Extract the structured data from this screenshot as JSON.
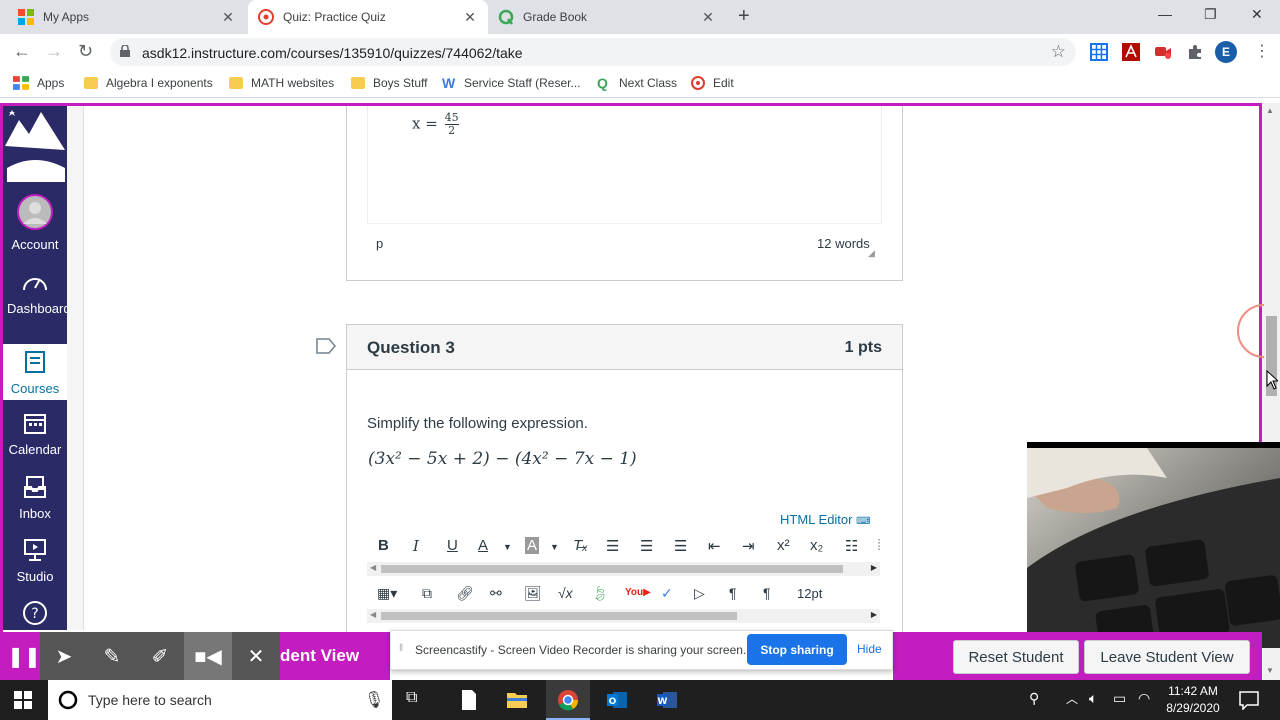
{
  "browser": {
    "tabs": [
      {
        "title": "My Apps",
        "active": false
      },
      {
        "title": "Quiz: Practice Quiz",
        "active": true
      },
      {
        "title": "Grade Book",
        "active": false
      }
    ],
    "url": "asdk12.instructure.com/courses/135910/quizzes/744062/take",
    "profile_initial": "E",
    "bookmarks": [
      "Apps",
      "Algebra I exponents",
      "MATH websites",
      "Boys Stuff",
      "Service Staff (Reser...",
      "Next Class",
      "Edit"
    ]
  },
  "canvas_nav": {
    "items": [
      {
        "label": "Account",
        "icon": "account-avatar-icon"
      },
      {
        "label": "Dashboard",
        "icon": "dashboard-gauge-icon"
      },
      {
        "label": "Courses",
        "icon": "courses-book-icon",
        "active": true
      },
      {
        "label": "Calendar",
        "icon": "calendar-icon"
      },
      {
        "label": "Inbox",
        "icon": "inbox-icon"
      },
      {
        "label": "Studio",
        "icon": "studio-icon"
      }
    ],
    "help_icon": "?"
  },
  "question2": {
    "answer_fragment_x": "x =",
    "answer_numerator": "45",
    "answer_denominator": "2",
    "path_tag": "p",
    "word_count": "12 words"
  },
  "question3": {
    "title": "Question 3",
    "points": "1 pts",
    "prompt": "Simplify the following expression.",
    "expression": "(3x² − 5x + 2) − (4x² − 7x − 1)",
    "html_editor_link": "HTML Editor",
    "font_size": "12pt"
  },
  "screencastify": {
    "student_view_fragment": "dent View",
    "share_message": "Screencastify - Screen Video Recorder is sharing your screen.",
    "stop_sharing": "Stop sharing",
    "hide": "Hide"
  },
  "student_view": {
    "reset": "Reset Student",
    "leave": "Leave Student View"
  },
  "taskbar": {
    "search_placeholder": "Type here to search",
    "time": "11:42 AM",
    "date": "8/29/2020"
  },
  "colors": {
    "accent_magenta": "#c31dbf",
    "canvas_nav": "#2a2a66",
    "link_blue": "#0770a3",
    "stop_sharing_blue": "#1a73e8"
  }
}
